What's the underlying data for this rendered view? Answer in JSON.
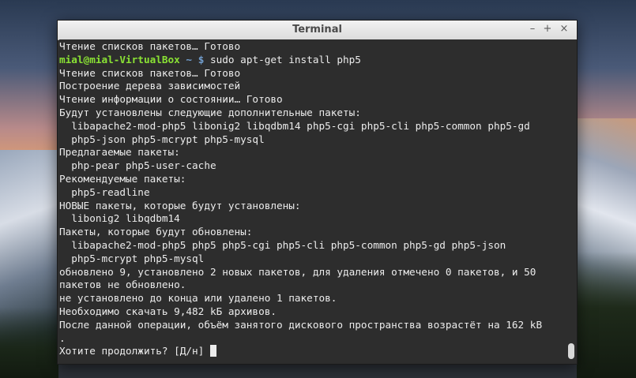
{
  "window": {
    "title": "Terminal",
    "min_icon": "–",
    "max_icon": "+",
    "close_icon": "×"
  },
  "terminal": {
    "line_1": "Чтение списков пакетов… Готово",
    "prompt_user": "mial@mial-VirtualBox",
    "prompt_path": " ~ $",
    "command": " sudo apt-get install php5",
    "line_3": "Чтение списков пакетов… Готово",
    "line_4": "Построение дерева зависимостей",
    "line_5": "Чтение информации о состоянии… Готово",
    "line_6": "Будут установлены следующие дополнительные пакеты:",
    "line_7": "  libapache2-mod-php5 libonig2 libqdbm14 php5-cgi php5-cli php5-common php5-gd",
    "line_8": "  php5-json php5-mcrypt php5-mysql",
    "line_9": "Предлагаемые пакеты:",
    "line_10": "  php-pear php5-user-cache",
    "line_11": "Рекомендуемые пакеты:",
    "line_12": "  php5-readline",
    "line_13": "НОВЫЕ пакеты, которые будут установлены:",
    "line_14": "  libonig2 libqdbm14",
    "line_15": "Пакеты, которые будут обновлены:",
    "line_16": "  libapache2-mod-php5 php5 php5-cgi php5-cli php5-common php5-gd php5-json",
    "line_17": "  php5-mcrypt php5-mysql",
    "line_18": "обновлено 9, установлено 2 новых пакетов, для удаления отмечено 0 пакетов, и 50",
    "line_19": "пакетов не обновлено.",
    "line_20": "не установлено до конца или удалено 1 пакетов.",
    "line_21": "Необходимо скачать 9,482 kБ архивов.",
    "line_22": "После данной операции, объём занятого дискового пространства возрастёт на 162 kB",
    "line_23": ".",
    "line_24": "Хотите продолжить? [Д/н] "
  }
}
